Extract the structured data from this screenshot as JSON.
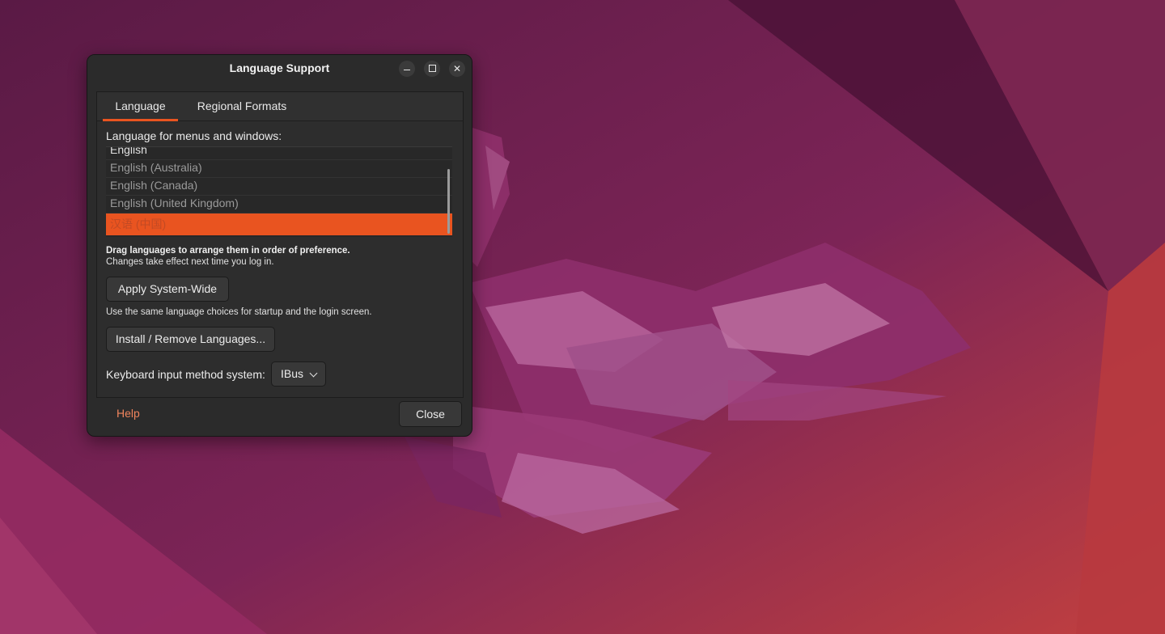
{
  "window": {
    "title": "Language Support"
  },
  "tabs": [
    {
      "label": "Language",
      "active": true
    },
    {
      "label": "Regional Formats",
      "active": false
    }
  ],
  "language_tab": {
    "menus_label": "Language for menus and windows:",
    "languages": [
      {
        "label": "English",
        "selected": false
      },
      {
        "label": "English (Australia)",
        "selected": false
      },
      {
        "label": "English (Canada)",
        "selected": false
      },
      {
        "label": "English (United Kingdom)",
        "selected": false
      },
      {
        "label": "汉语 (中国)",
        "selected": true
      }
    ],
    "drag_hint": "Drag languages to arrange them in order of preference.",
    "effect_hint": "Changes take effect next time you log in.",
    "apply_button": "Apply System-Wide",
    "apply_hint": "Use the same language choices for startup and the login screen.",
    "install_button": "Install / Remove Languages...",
    "keyboard_label": "Keyboard input method system:",
    "keyboard_value": "IBus"
  },
  "footer": {
    "help_label": "Help",
    "close_label": "Close"
  },
  "colors": {
    "accent": "#e95420",
    "link": "#f0845d",
    "window_bg": "#2b2b2b"
  },
  "icons": {
    "minimize": "minimize-icon",
    "maximize": "maximize-icon",
    "close": "close-icon",
    "dropdown": "chevron-down-icon"
  }
}
